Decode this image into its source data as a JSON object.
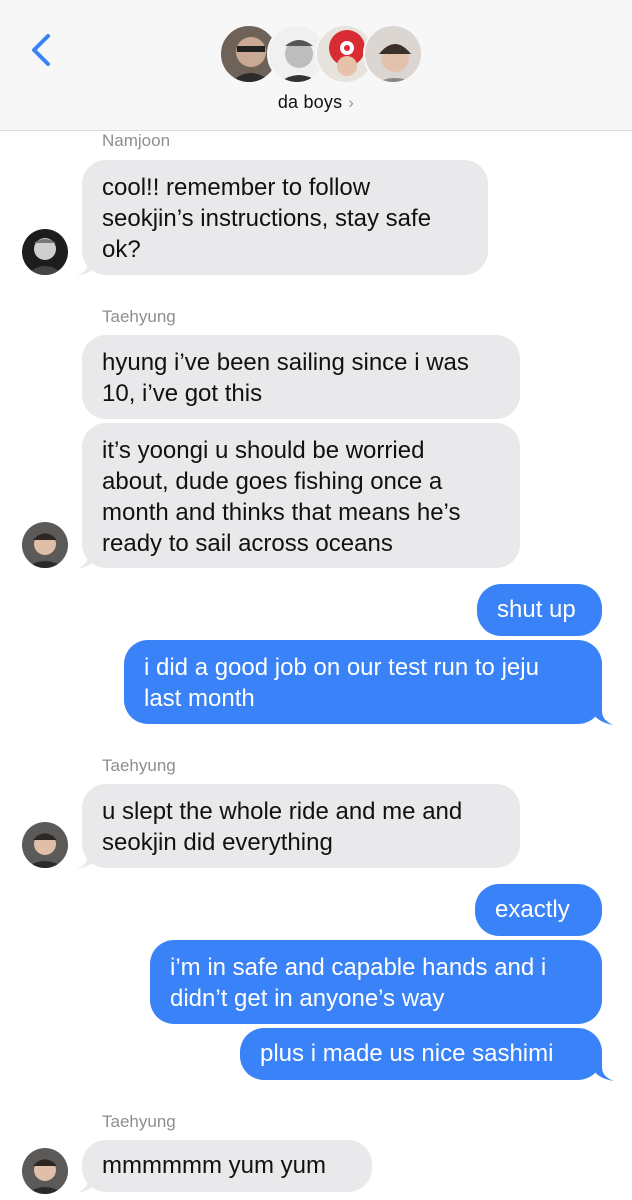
{
  "header": {
    "group_name": "da boys",
    "chevron": "›",
    "back_icon": "chevron-left-icon",
    "accent": "#3a82f7"
  },
  "messages": [
    {
      "sender": "Namjoon",
      "lines": [
        "cool!! remember to follow",
        "seokjin’s instructions, stay safe",
        "ok?"
      ]
    },
    {
      "sender": "Taehyung",
      "lines": [
        "hyung i’ve been sailing since i was",
        "10, i’ve got this"
      ]
    },
    {
      "lines": [
        "it’s yoongi u should be worried",
        "about, dude goes fishing once a",
        "month and thinks that means he’s",
        "ready to sail across oceans"
      ]
    },
    {
      "from_me": true,
      "lines": [
        "shut up"
      ]
    },
    {
      "from_me": true,
      "lines": [
        "i did a good job on our test run to jeju",
        "last month"
      ]
    },
    {
      "sender": "Taehyung",
      "lines": [
        "u slept the whole ride and me and",
        "seokjin did everything"
      ]
    },
    {
      "from_me": true,
      "lines": [
        "exactly"
      ]
    },
    {
      "from_me": true,
      "lines": [
        "i’m in safe and capable hands and i",
        "didn’t get in anyone’s way"
      ]
    },
    {
      "from_me": true,
      "lines": [
        "plus i made us nice sashimi"
      ]
    },
    {
      "sender": "Taehyung",
      "lines": [
        "mmmmmm yum yum"
      ]
    }
  ]
}
